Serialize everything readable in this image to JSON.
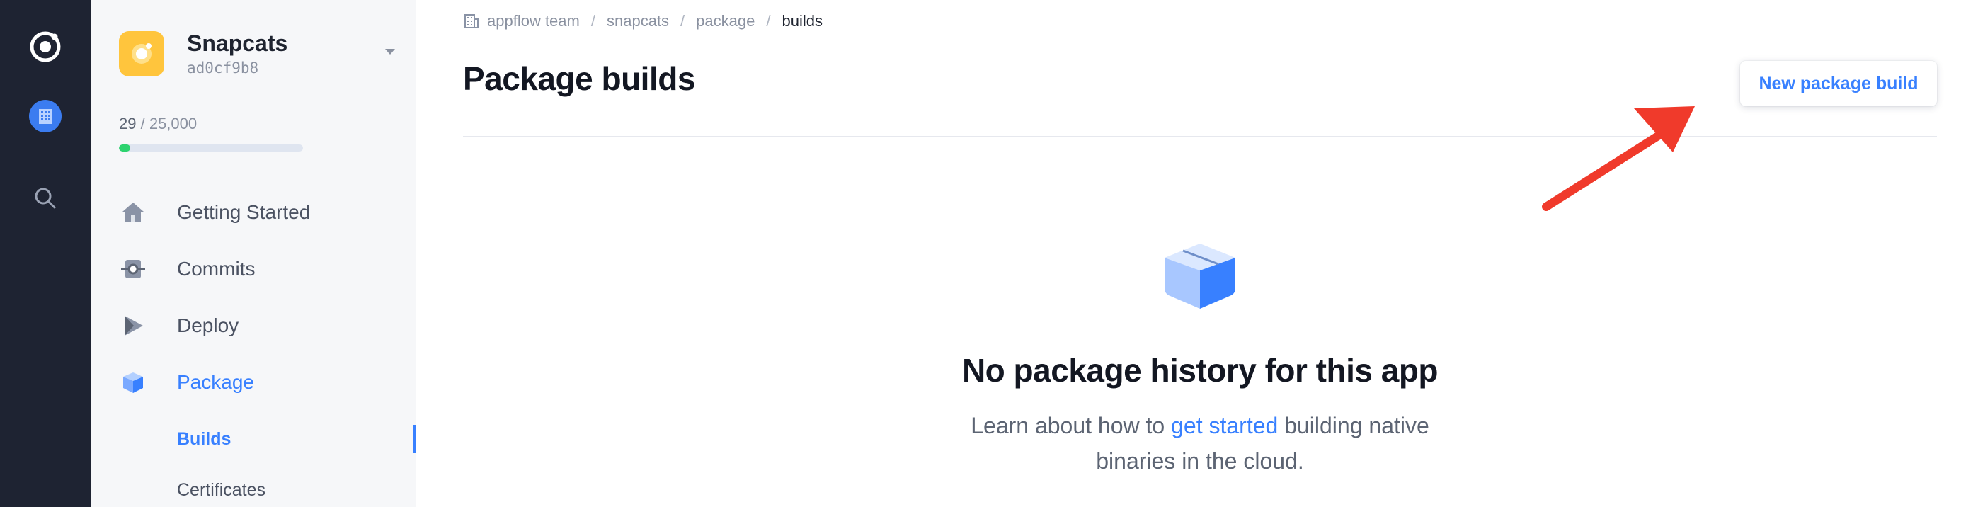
{
  "rail": {
    "items": [
      {
        "icon": "ionic-logo-icon"
      },
      {
        "icon": "building-icon"
      },
      {
        "icon": "search-icon"
      }
    ]
  },
  "app": {
    "name": "Snapcats",
    "id": "ad0cf9b8",
    "usage_used": "29",
    "usage_separator": " / ",
    "usage_limit": "25,000",
    "usage_fraction": 0.06,
    "accent": "#ffc53d"
  },
  "nav": {
    "items": [
      {
        "label": "Getting Started",
        "icon": "home-icon"
      },
      {
        "label": "Commits",
        "icon": "commit-icon"
      },
      {
        "label": "Deploy",
        "icon": "play-icon"
      },
      {
        "label": "Package",
        "icon": "cube-icon",
        "active": true
      }
    ],
    "sub_items": [
      {
        "label": "Builds",
        "active": true
      },
      {
        "label": "Certificates"
      }
    ]
  },
  "breadcrumb": {
    "items": [
      "appflow team",
      "snapcats",
      "package"
    ],
    "current": "builds",
    "separator": "/"
  },
  "page": {
    "title": "Package builds",
    "primary_button": "New package build"
  },
  "empty_state": {
    "title": "No package history for this app",
    "desc_before": "Learn about how to ",
    "desc_link": "get started",
    "desc_after": " building native binaries in the cloud."
  },
  "colors": {
    "primary": "#3880ff",
    "rail_bg": "#1e2332",
    "sidebar_bg": "#f6f7f9",
    "annotation_arrow": "#f03a2b",
    "usage_fill": "#2dd36f"
  }
}
